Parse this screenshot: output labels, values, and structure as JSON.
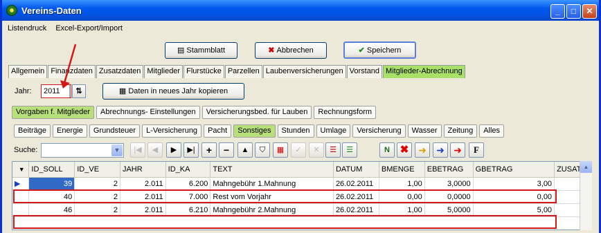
{
  "window": {
    "title": "Vereins-Daten",
    "min": "_",
    "max": "□",
    "close": "✕"
  },
  "menu": [
    "Listendruck",
    "Excel-Export/Import"
  ],
  "top_buttons": {
    "stammblatt": "Stammblatt",
    "abbrechen": "Abbrechen",
    "speichern": "Speichern"
  },
  "main_tabs": [
    "Allgemein",
    "Finanzdaten",
    "Zusatzdaten",
    "Mitglieder",
    "Flurstücke",
    "Parzellen",
    "Laubenversicherungen",
    "Vorstand",
    "Mitglieder-Abrechnung"
  ],
  "jahr": {
    "label": "Jahr:",
    "value": "2011",
    "copy_button": "Daten in neues Jahr kopieren"
  },
  "sub_tabs": [
    "Vorgaben f. Mitglieder",
    "Abrechnungs- Einstellungen",
    "Versicherungsbed. für Lauben",
    "Rechnungsform"
  ],
  "category_tabs": [
    "Beiträge",
    "Energie",
    "Grundsteuer",
    "L-Versicherung",
    "Pacht",
    "Sonstiges",
    "Stunden",
    "Umlage",
    "Versicherung",
    "Wasser",
    "Zeitung",
    "Alles"
  ],
  "search": {
    "label": "Suche:",
    "value": ""
  },
  "grid": {
    "columns": [
      "ID_SOLL",
      "ID_VE",
      "JAHR",
      "ID_KA",
      "TEXT",
      "DATUM",
      "BMENGE",
      "EBETRAG",
      "GBETRAG",
      "ZUSAT"
    ],
    "rows": [
      [
        "39",
        "2",
        "2.011",
        "6.200",
        "Mahngebühr 1.Mahnung",
        "26.02.2011",
        "1,00",
        "3,0000",
        "3,00"
      ],
      [
        "40",
        "2",
        "2.011",
        "7.000",
        "Rest vom Vorjahr",
        "26.02.2011",
        "0,00",
        "0,0000",
        "0,00"
      ],
      [
        "46",
        "2",
        "2.011",
        "6.210",
        "Mahngebühr 2.Mahnung",
        "26.02.2011",
        "1,00",
        "5,0000",
        "5,00"
      ]
    ]
  },
  "colors": {
    "active_tab": "#a9e067",
    "title_bar": "#0054e3",
    "highlight": "#d41717"
  }
}
